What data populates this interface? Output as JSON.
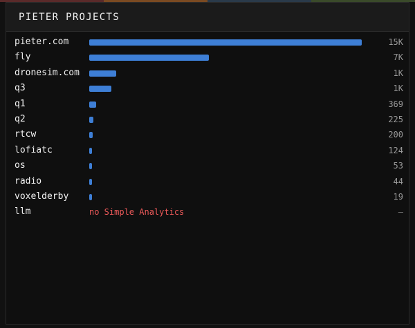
{
  "panel": {
    "title": "PIETER PROJECTS"
  },
  "colors": {
    "bar": "#3e7fd6",
    "note": "#ee5a5a",
    "background": "#0f0f0f",
    "header": "#1b1b1b",
    "stripe": [
      "#5a2a2a",
      "#7a4a22",
      "#2a3a4a",
      "#3a4a2a"
    ]
  },
  "chart_data": {
    "type": "bar",
    "orientation": "horizontal",
    "title": "PIETER PROJECTS",
    "xlim": [
      0,
      15000
    ],
    "grid": false,
    "categories": [
      "pieter.com",
      "fly",
      "dronesim.com",
      "q3",
      "q1",
      "q2",
      "rtcw",
      "lofiatc",
      "os",
      "radio",
      "voxelderby",
      "llm"
    ],
    "values": [
      15000,
      6600,
      1500,
      1200,
      369,
      225,
      200,
      124,
      53,
      44,
      19,
      null
    ],
    "value_labels": [
      "15K",
      "7K",
      "1K",
      "1K",
      "369",
      "225",
      "200",
      "124",
      "53",
      "44",
      "19",
      "–"
    ],
    "notes": [
      "",
      "",
      "",
      "",
      "",
      "",
      "",
      "",
      "",
      "",
      "",
      "no Simple Analytics"
    ]
  }
}
